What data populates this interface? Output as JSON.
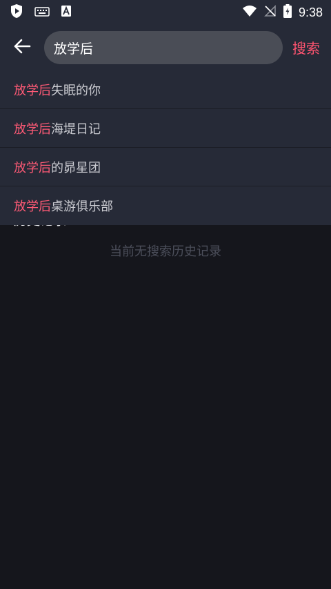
{
  "status_bar": {
    "time": "9:38",
    "icons": [
      "play-shield-icon",
      "keyboard-icon",
      "font-a-icon",
      "wifi-icon",
      "no-signal-icon",
      "battery-charging-icon"
    ]
  },
  "header": {
    "back_icon": "arrow-left-icon",
    "search_value": "放学后",
    "search_button": "搜索"
  },
  "suggestions": [
    {
      "highlight": "放学后",
      "rest": "失眠的你"
    },
    {
      "highlight": "放学后",
      "rest": "海堤日记"
    },
    {
      "highlight": "放学后",
      "rest": "的昴星团"
    },
    {
      "highlight": "放学后",
      "rest": "桌游俱乐部"
    }
  ],
  "history": {
    "title": "历史记录",
    "empty_message": "当前无搜索历史记录",
    "clear_icon": "trash-icon"
  },
  "colors": {
    "accent": "#ff5470",
    "bar_bg": "#262a37",
    "page_bg": "#15161c"
  }
}
